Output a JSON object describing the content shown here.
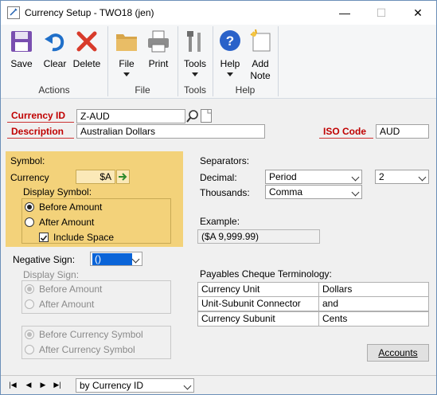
{
  "window": {
    "title": "Currency Setup  -  TWO18 (jen)",
    "minimize_glyph": "—",
    "maximize_glyph": "☐",
    "close_glyph": "✕"
  },
  "ribbon": {
    "save": "Save",
    "clear": "Clear",
    "delete": "Delete",
    "file": "File",
    "print": "Print",
    "tools": "Tools",
    "help": "Help",
    "add_note_1": "Add",
    "add_note_2": "Note",
    "groups": {
      "actions": "Actions",
      "file": "File",
      "tools": "Tools",
      "help": "Help"
    }
  },
  "form": {
    "currency_id_label": "Currency ID",
    "currency_id_value": "Z-AUD",
    "description_label": "Description",
    "description_value": "Australian Dollars",
    "iso_code_label": "ISO Code",
    "iso_code_value": "AUD",
    "symbol_label": "Symbol:",
    "currency_label": "Currency",
    "currency_symbol_value": "$A",
    "display_symbol_label": "Display Symbol:",
    "before_amount": "Before Amount",
    "after_amount": "After Amount",
    "include_space": "Include Space",
    "negative_sign_label": "Negative Sign:",
    "negative_sign_value": "()",
    "display_sign_label": "Display Sign:",
    "sign_before_amount": "Before Amount",
    "sign_after_amount": "After Amount",
    "before_currency_symbol": "Before Currency Symbol",
    "after_currency_symbol": "After Currency Symbol",
    "separators_label": "Separators:",
    "decimal_label": "Decimal:",
    "decimal_value": "Period",
    "decimal_places_value": "2",
    "thousands_label": "Thousands:",
    "thousands_value": "Comma",
    "example_label": "Example:",
    "example_value": "($A 9,999.99)",
    "payables_label": "Payables Cheque Terminology:",
    "terminology": [
      {
        "label": "Currency Unit",
        "value": "Dollars"
      },
      {
        "label": "Unit-Subunit Connector",
        "value": "and"
      },
      {
        "label": "Currency Subunit",
        "value": "Cents"
      }
    ],
    "accounts_button": "Accounts"
  },
  "statusbar": {
    "sort_value": "by Currency ID",
    "nav_first": "|◀",
    "nav_prev": "◀",
    "nav_next": "▶",
    "nav_last": "▶|"
  },
  "colors": {
    "accent_red": "#c00000",
    "highlight_yellow": "#f3d27a",
    "selection_blue": "#0a64d8"
  }
}
